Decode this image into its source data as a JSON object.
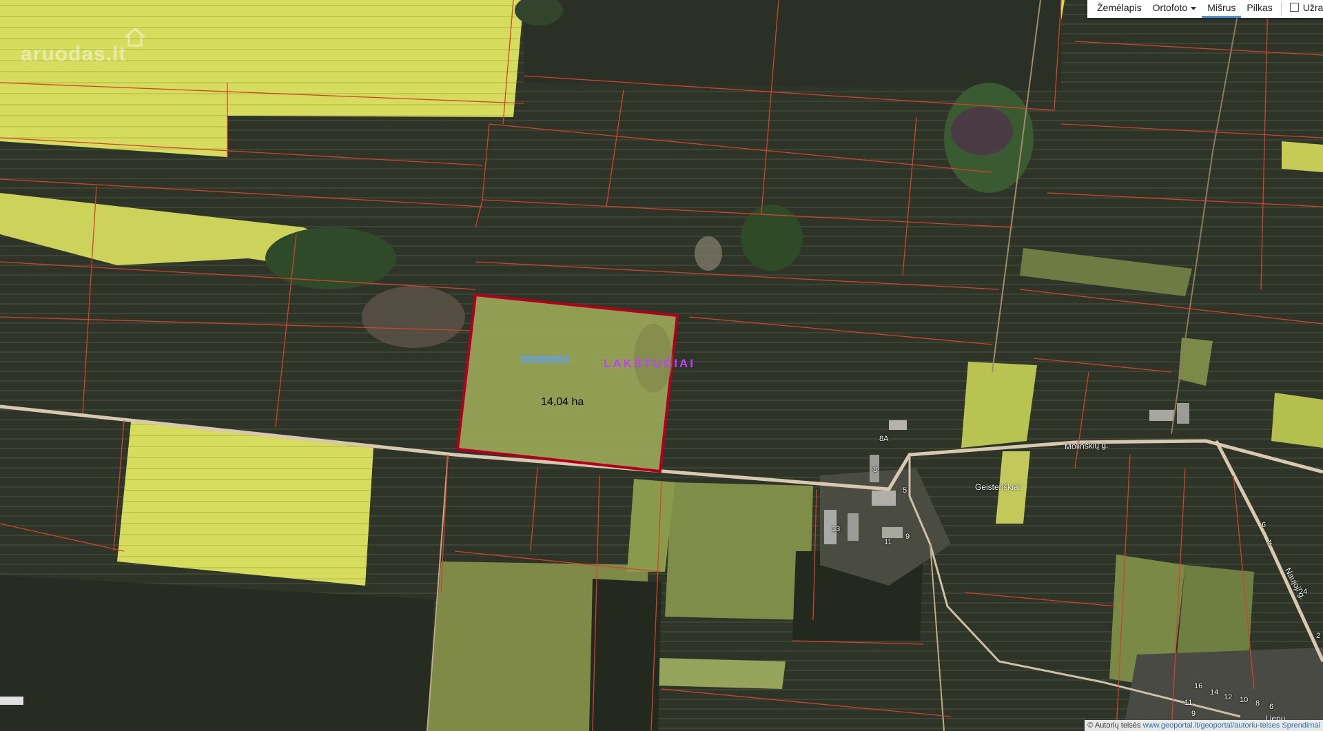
{
  "toolbar": {
    "items": [
      "Žemėlapis",
      "Ortofoto",
      "Mišrus",
      "Pilkas"
    ],
    "active": "Mišrus",
    "notes_checkbox_label": "Užrašai"
  },
  "watermark": "aruodas.lt",
  "parcel": {
    "number": "39380003",
    "place": "LAKŠTUČIAI",
    "area": "14,04 ha",
    "border_color": "#b0001e"
  },
  "places": {
    "village": "Geisteriškiai",
    "street1": "Molinškių g.",
    "street2": "Naujoji g.",
    "street3": "Liepų"
  },
  "house_numbers": [
    "8A",
    "8",
    "5",
    "13",
    "11",
    "9",
    "6",
    "4",
    "24",
    "2",
    "16",
    "14",
    "12",
    "10",
    "8",
    "6",
    "11",
    "9"
  ],
  "attribution": {
    "prefix": "© Autorių teisės",
    "link": "www.geoportal.lt/geoportal/autoriu-teises",
    "suffix": "Sprendimai"
  },
  "colors": {
    "field_dark": "#2e3428",
    "field_yellow": "#d8dc5a",
    "field_green": "#8c9a4a",
    "cadastre_line": "#d0432c",
    "road": "#e8d8c0"
  }
}
